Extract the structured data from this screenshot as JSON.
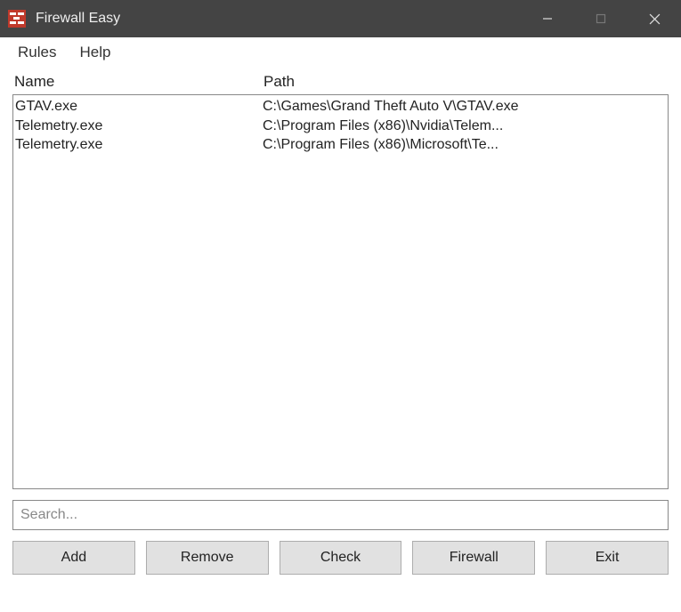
{
  "window": {
    "title": "Firewall Easy"
  },
  "menu": {
    "items": [
      "Rules",
      "Help"
    ]
  },
  "columns": {
    "name": "Name",
    "path": "Path"
  },
  "rows": [
    {
      "name": "GTAV.exe",
      "path": "C:\\Games\\Grand Theft Auto V\\GTAV.exe"
    },
    {
      "name": "Telemetry.exe",
      "path": "C:\\Program Files (x86)\\Nvidia\\Telem..."
    },
    {
      "name": "Telemetry.exe",
      "path": "C:\\Program Files (x86)\\Microsoft\\Te..."
    }
  ],
  "search": {
    "placeholder": "Search...",
    "value": ""
  },
  "buttons": {
    "add": "Add",
    "remove": "Remove",
    "check": "Check",
    "firewall": "Firewall",
    "exit": "Exit"
  }
}
